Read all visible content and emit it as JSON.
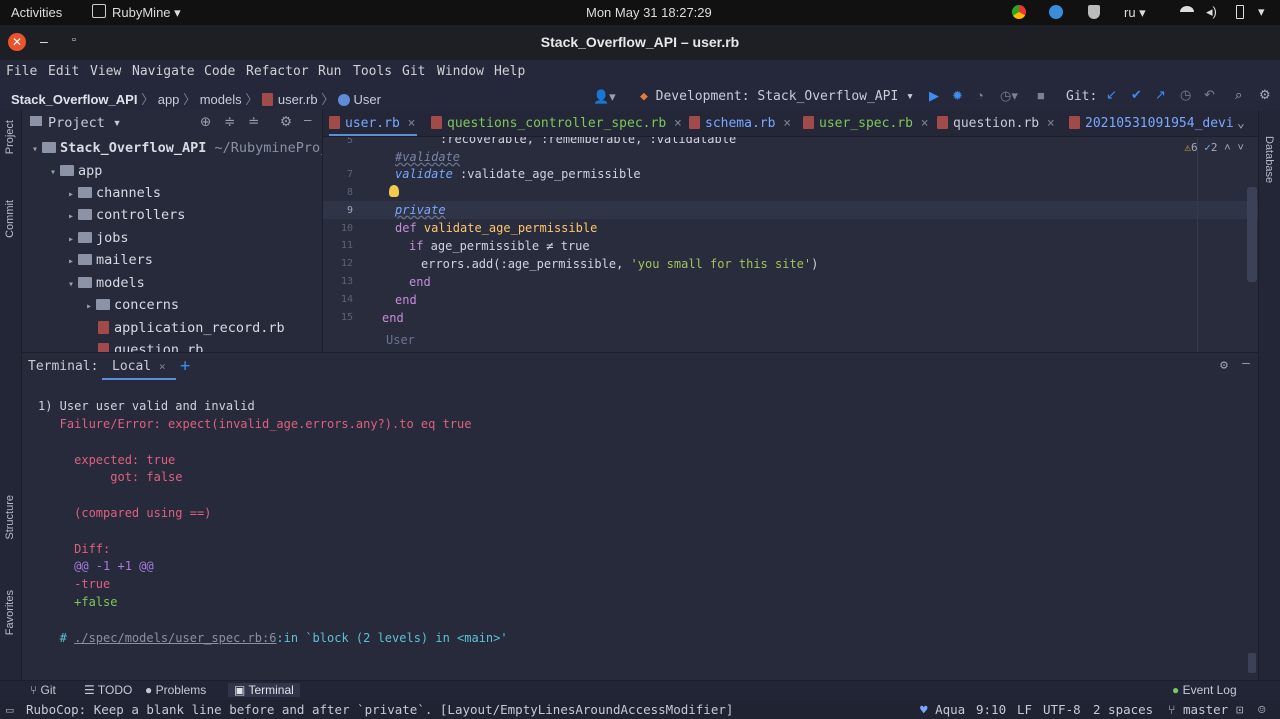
{
  "os": {
    "activities": "Activities",
    "app": "RubyMine",
    "clock": "Mon May 31  18:27:29",
    "lang": "ru"
  },
  "window": {
    "title": "Stack_Overflow_API – user.rb"
  },
  "menu": [
    "File",
    "Edit",
    "View",
    "Navigate",
    "Code",
    "Refactor",
    "Run",
    "Tools",
    "Git",
    "Window",
    "Help"
  ],
  "breadcrumb": [
    "Stack_Overflow_API",
    "app",
    "models",
    "user.rb",
    "User"
  ],
  "run": {
    "config": "Development: Stack_Overflow_API",
    "git_label": "Git:"
  },
  "project": {
    "header": "Project",
    "root": "Stack_Overflow_API",
    "root_path": "~/RubymineProjects",
    "items": [
      {
        "label": "app",
        "level": 1,
        "type": "folder",
        "open": true
      },
      {
        "label": "channels",
        "level": 2,
        "type": "folder"
      },
      {
        "label": "controllers",
        "level": 2,
        "type": "folder"
      },
      {
        "label": "jobs",
        "level": 2,
        "type": "folder"
      },
      {
        "label": "mailers",
        "level": 2,
        "type": "folder"
      },
      {
        "label": "models",
        "level": 2,
        "type": "folder",
        "open": true
      },
      {
        "label": "concerns",
        "level": 3,
        "type": "folder"
      },
      {
        "label": "application_record.rb",
        "level": 3,
        "type": "file"
      },
      {
        "label": "question.rb",
        "level": 3,
        "type": "file"
      }
    ]
  },
  "tabs": [
    "user.rb",
    "questions_controller_spec.rb",
    "schema.rb",
    "user_spec.rb",
    "question.rb",
    "20210531091954_devi"
  ],
  "inspections": {
    "warnings": "6",
    "weak": "2"
  },
  "editor": {
    "line_numbers": [
      "5",
      "7",
      "8",
      "9",
      "10",
      "11",
      "12",
      "13",
      "14",
      "15"
    ],
    "lines": {
      "l5": ":recoverable, :rememberable, :validatable",
      "l6": "#validate",
      "l7a": "validate",
      "l7b": " :validate_age_permissible",
      "l9": "private",
      "l10a": "def ",
      "l10b": "validate_age_permissible",
      "l11a": "if",
      "l11b": " age_permissible ≠ true",
      "l12a": "errors.add(:age_permissible, ",
      "l12b": "'you small for this site'",
      "l12c": ")",
      "l13": "end",
      "l14": "end",
      "l15": "end"
    },
    "breadcrumb_hint": "User"
  },
  "terminal": {
    "label": "Terminal:",
    "tab": "Local",
    "lines": {
      "t1": "1) User user valid and invalid",
      "t2": "   Failure/Error: expect(invalid_age.errors.any?).to eq true",
      "t3": "     expected: true",
      "t4": "          got: false",
      "t5": "     (compared using ==)",
      "t6": "     Diff:",
      "t7": "     @@ -1 +1 @@",
      "t8": "     -true",
      "t9": "     +false",
      "t10a": "   # ",
      "t10b": "./spec/models/user_spec.rb:6",
      "t10c": ":in `block (2 levels) in <main>'"
    }
  },
  "side_tabs": {
    "project": "Project",
    "commit": "Commit",
    "structure": "Structure",
    "favorites": "Favorites",
    "database": "Database"
  },
  "bottom_tools": [
    "Git",
    "TODO",
    "Problems",
    "Terminal"
  ],
  "event_log": "Event Log",
  "status": {
    "message": "RuboCop: Keep a blank line before and after `private`. [Layout/EmptyLinesAroundAccessModifier]",
    "theme": "Aqua",
    "position": "9:10",
    "line_sep": "LF",
    "encoding": "UTF-8",
    "indent": "2 spaces",
    "branch": "master"
  },
  "colors": {
    "accent": "#5f8cd6",
    "error": "#e0607e",
    "diff_add": "#7ec75b",
    "diff_hunk": "#a77be0"
  }
}
